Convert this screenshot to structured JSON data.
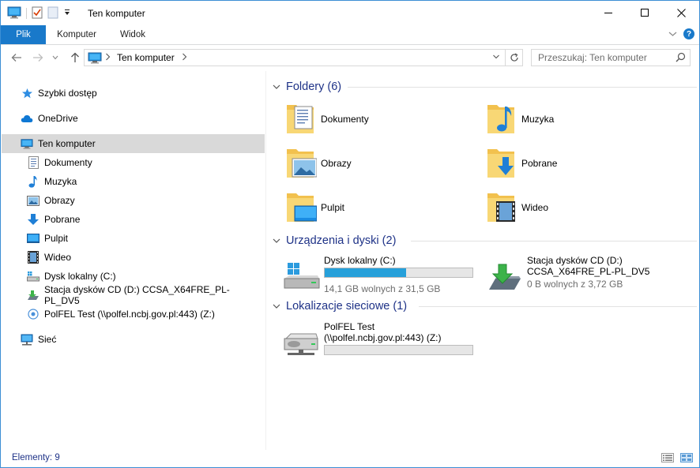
{
  "window": {
    "title": "Ten komputer"
  },
  "ribbon": {
    "tabs": [
      {
        "label": "Plik"
      },
      {
        "label": "Komputer"
      },
      {
        "label": "Widok"
      }
    ],
    "help_label": "?"
  },
  "address": {
    "crumbs": [
      "Ten komputer"
    ]
  },
  "search": {
    "placeholder": "Przeszukaj: Ten komputer"
  },
  "navpane": {
    "items": [
      {
        "label": "Szybki dostęp",
        "icon": "star-icon"
      },
      {
        "label": "OneDrive",
        "icon": "cloud-icon"
      },
      {
        "label": "Ten komputer",
        "icon": "computer-icon"
      },
      {
        "label": "Dokumenty",
        "icon": "documents-icon"
      },
      {
        "label": "Muzyka",
        "icon": "music-icon"
      },
      {
        "label": "Obrazy",
        "icon": "pictures-icon"
      },
      {
        "label": "Pobrane",
        "icon": "downloads-icon"
      },
      {
        "label": "Pulpit",
        "icon": "desktop-icon"
      },
      {
        "label": "Wideo",
        "icon": "video-icon"
      },
      {
        "label": "Dysk lokalny (C:)",
        "icon": "local-disk-icon"
      },
      {
        "label": "Stacja dysków CD (D:) CCSA_X64FRE_PL-PL_DV5",
        "icon": "cd-drive-icon"
      },
      {
        "label": "PolFEL Test (\\\\polfel.ncbj.gov.pl:443) (Z:)",
        "icon": "network-drive-icon"
      },
      {
        "label": "Sieć",
        "icon": "network-icon"
      }
    ]
  },
  "content": {
    "folders_header": "Foldery (6)",
    "folders": [
      {
        "label": "Dokumenty",
        "icon": "documents-folder-icon"
      },
      {
        "label": "Muzyka",
        "icon": "music-folder-icon"
      },
      {
        "label": "Obrazy",
        "icon": "pictures-folder-icon"
      },
      {
        "label": "Pobrane",
        "icon": "downloads-folder-icon"
      },
      {
        "label": "Pulpit",
        "icon": "desktop-folder-icon"
      },
      {
        "label": "Wideo",
        "icon": "video-folder-icon"
      }
    ],
    "devices_header": "Urządzenia i dyski (2)",
    "drives": [
      {
        "name": "Dysk lokalny (C:)",
        "free": "14,1 GB wolnych z 31,5 GB",
        "used_fraction": 0.55,
        "icon": "local-disk-icon"
      },
      {
        "name_line1": "Stacja dysków CD (D:)",
        "name_line2": "CCSA_X64FRE_PL-PL_DV5",
        "free": "0 B wolnych z 3,72 GB",
        "icon": "cd-drive-icon"
      }
    ],
    "network_header": "Lokalizacje sieciowe (1)",
    "network": [
      {
        "name_line1": "PolFEL Test",
        "name_line2": "(\\\\polfel.ncbj.gov.pl:443) (Z:)",
        "used_fraction": 0,
        "icon": "network-drive-icon"
      }
    ]
  },
  "status": {
    "items_text": "Elementy: 9"
  },
  "colors": {
    "accent": "#1979ca",
    "header_text": "#1e3287",
    "selection": "#d9d9d9",
    "progress": "#26a0da"
  }
}
